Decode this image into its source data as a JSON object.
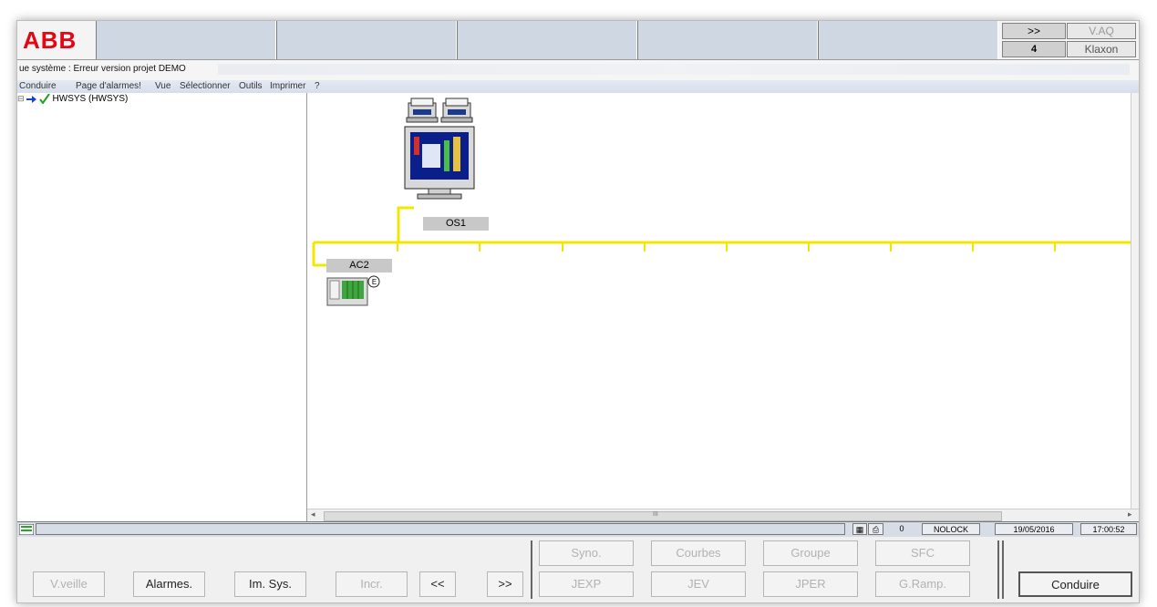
{
  "app": {
    "logo": "ABB",
    "title": "ue système : Erreur version projet DEMO"
  },
  "top_buttons": {
    "more": ">>",
    "count": "4",
    "v_aq": "V.AQ",
    "klaxon": "Klaxon"
  },
  "menu": {
    "items": [
      "Conduire",
      "Page d'alarmes!",
      "Vue",
      "Sélectionner",
      "Outils",
      "Imprimer",
      "?"
    ]
  },
  "tree": {
    "root_label": "HWSYS (HWSYS)",
    "expander": "⊟"
  },
  "diagram": {
    "os_label": "OS1",
    "ac_label": "AC2",
    "ac_badge": "E",
    "bus_color": "#f0e800"
  },
  "scroll": {
    "grip": "III"
  },
  "status": {
    "number": "0",
    "lock": "NOLOCK",
    "date": "19/05/2016",
    "time": "17:00:52"
  },
  "buttons": {
    "veille": "V.veille",
    "alarmes": "Alarmes.",
    "imsys": "Im. Sys.",
    "incr": "Incr.",
    "prev": "<<",
    "next": ">>",
    "syno": "Syno.",
    "courbes": "Courbes",
    "groupe": "Groupe",
    "sfc": "SFC",
    "jexp": "JEXP",
    "jev": "JEV",
    "jper": "JPER",
    "gramp": "G.Ramp.",
    "conduire": "Conduire"
  }
}
